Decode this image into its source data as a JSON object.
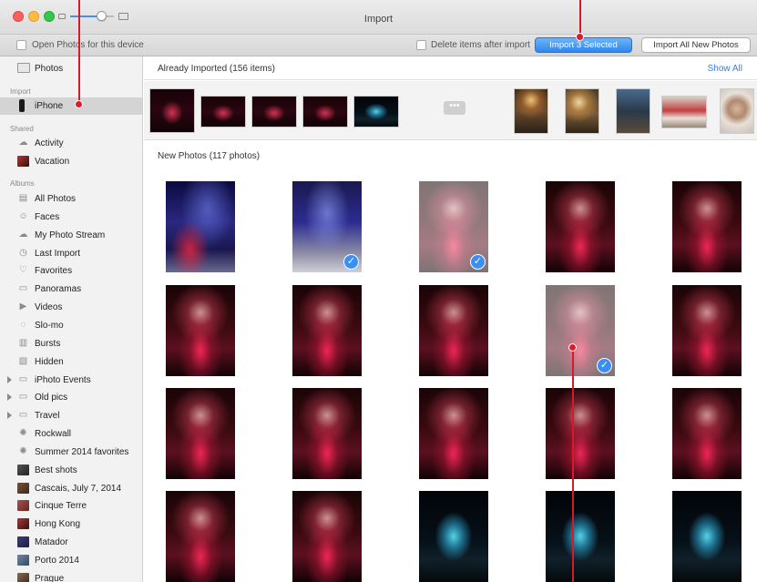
{
  "window": {
    "title": "Import"
  },
  "toolbar": {
    "open_photos_label": "Open Photos for this device",
    "delete_items_label": "Delete items after import",
    "import_selected_label": "Import 3 Selected",
    "import_all_label": "Import All New Photos"
  },
  "sidebar": {
    "photos_label": "Photos",
    "import_header": "Import",
    "iphone_label": "iPhone",
    "shared_header": "Shared",
    "activity_label": "Activity",
    "vacation_label": "Vacation",
    "albums_header": "Albums",
    "albums": [
      {
        "label": "All Photos",
        "icon": "all-photos-icon"
      },
      {
        "label": "Faces",
        "icon": "faces-icon"
      },
      {
        "label": "My Photo Stream",
        "icon": "cloud-icon"
      },
      {
        "label": "Last Import",
        "icon": "clock-icon"
      },
      {
        "label": "Favorites",
        "icon": "heart-icon"
      },
      {
        "label": "Panoramas",
        "icon": "panorama-icon"
      },
      {
        "label": "Videos",
        "icon": "video-icon"
      },
      {
        "label": "Slo-mo",
        "icon": "slomo-icon"
      },
      {
        "label": "Bursts",
        "icon": "bursts-icon"
      },
      {
        "label": "Hidden",
        "icon": "hidden-icon"
      },
      {
        "label": "iPhoto Events",
        "icon": "folder-icon"
      },
      {
        "label": "Old pics",
        "icon": "folder-icon"
      },
      {
        "label": "Travel",
        "icon": "folder-icon"
      },
      {
        "label": "Rockwall",
        "icon": "gear-icon"
      },
      {
        "label": "Summer 2014 favorites",
        "icon": "gear-icon"
      },
      {
        "label": "Best shots",
        "icon": "album-thumbnail"
      },
      {
        "label": "Cascais, July 7, 2014",
        "icon": "album-thumbnail"
      },
      {
        "label": "Cinque Terre",
        "icon": "album-thumbnail"
      },
      {
        "label": "Hong Kong",
        "icon": "album-thumbnail"
      },
      {
        "label": "Matador",
        "icon": "album-thumbnail"
      },
      {
        "label": "Porto 2014",
        "icon": "album-thumbnail"
      },
      {
        "label": "Prague",
        "icon": "album-thumbnail"
      }
    ]
  },
  "main": {
    "already_imported_title": "Already Imported (156 items)",
    "show_all_label": "Show All",
    "more_dots": "•••",
    "new_photos_title": "New Photos (117 photos)"
  },
  "colors": {
    "accent": "#2f86f0",
    "selection_check": "#3a8ef6",
    "annotation": "#e0192b"
  }
}
